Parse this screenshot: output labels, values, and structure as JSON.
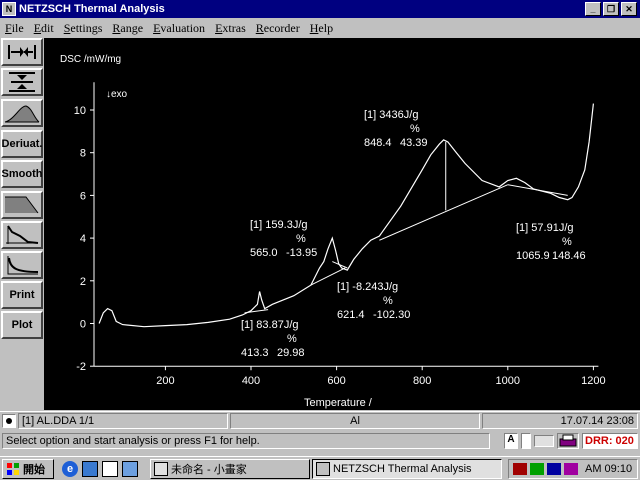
{
  "window": {
    "title": "NETZSCH Thermal Analysis",
    "icon": "netzsch-app-icon"
  },
  "menu": [
    "File",
    "Edit",
    "Settings",
    "Range",
    "Evaluation",
    "Extras",
    "Recorder",
    "Help"
  ],
  "toolbar": {
    "derivat_label": "Deriuat.",
    "smooth_label": "Smooth",
    "print_label": "Print",
    "plot_label": "Plot"
  },
  "plot": {
    "ylabel": "DSC /mW/mg",
    "exo_label": "↓exo",
    "xlabel": "Temperature /",
    "annotations": [
      {
        "l1": "[1] 159.3J/g",
        "l2": "%",
        "l3a": "565.0",
        "l3b": "-13.95"
      },
      {
        "l1": "[1] 3436J/g",
        "l2": "%",
        "l3a": "848.4",
        "l3b": "43.39"
      },
      {
        "l1": "[1] 57.91J/g",
        "l2": "%",
        "l3a": "1065.9",
        "l3b": "148.46"
      },
      {
        "l1": "[1] -8.243J/g",
        "l2": "%",
        "l3a": "621.4",
        "l3b": "-102.30"
      },
      {
        "l1": "[1] 83.87J/g",
        "l2": "%",
        "l3a": "413.3",
        "l3b": "29.98"
      }
    ]
  },
  "chart_data": {
    "type": "line",
    "xlabel": "Temperature /",
    "ylabel": "DSC /mW/mg",
    "xlim": [
      0,
      1200
    ],
    "ylim": [
      -2,
      10.5
    ],
    "xticks": [
      200,
      400,
      600,
      800,
      1000,
      1200
    ],
    "yticks": [
      -2,
      0,
      2,
      4,
      6,
      8,
      10
    ],
    "series": [
      {
        "x": [
          45,
          55,
          65,
          75,
          85,
          100,
          150,
          200,
          250,
          300,
          350,
          380,
          400,
          415,
          420,
          425,
          432,
          450,
          500,
          540,
          560,
          570,
          580,
          590,
          598,
          605,
          612,
          625,
          640,
          660,
          680,
          700,
          750,
          800,
          820,
          840,
          850,
          860,
          880,
          900,
          940,
          980,
          1000,
          1020,
          1040,
          1060,
          1100,
          1120,
          1140,
          1150,
          1165,
          1180,
          1190,
          1200
        ],
        "y": [
          0.0,
          0.5,
          0.7,
          0.6,
          0.1,
          -0.05,
          -0.15,
          -0.1,
          -0.05,
          0.05,
          0.2,
          0.4,
          0.6,
          0.9,
          1.5,
          1.1,
          0.7,
          0.9,
          1.3,
          1.8,
          2.6,
          2.9,
          3.5,
          4.0,
          3.4,
          2.8,
          2.6,
          2.5,
          3.0,
          3.5,
          3.9,
          4.1,
          5.5,
          7.2,
          7.9,
          8.4,
          8.6,
          8.5,
          8.0,
          7.5,
          6.7,
          6.4,
          6.7,
          6.8,
          6.6,
          6.3,
          6.1,
          5.9,
          5.8,
          5.9,
          6.4,
          7.2,
          8.5,
          10.3
        ]
      }
    ],
    "baselines": [
      {
        "x": [
          385,
          440
        ],
        "y": [
          0.5,
          0.65
        ]
      },
      {
        "x": [
          540,
          620
        ],
        "y": [
          1.8,
          2.6
        ]
      },
      {
        "x": [
          590,
          625
        ],
        "y": [
          2.9,
          2.6
        ]
      },
      {
        "x": [
          700,
          1000
        ],
        "y": [
          3.9,
          6.5
        ]
      },
      {
        "x": [
          1000,
          1140
        ],
        "y": [
          6.5,
          6.0
        ]
      }
    ],
    "markers": [
      {
        "x": 855,
        "y1": 5.3,
        "y2": 8.5
      }
    ]
  },
  "status": {
    "file": "[1] AL.DDA  1/1",
    "sample": "Al",
    "datetime": "17.07.14 23:08",
    "help": "Select option and start analysis or press F1 for help.",
    "drr": "DRR: 020"
  },
  "taskbar": {
    "start": "開始",
    "task1": "未命名 - 小畫家",
    "task2": "NETZSCH Thermal Analysis",
    "clock": "AM 09:10"
  },
  "colors": {
    "title_bg": "#000080",
    "plot_bg": "#000000",
    "curve": "#ffffff",
    "drr": "#cc0000"
  }
}
